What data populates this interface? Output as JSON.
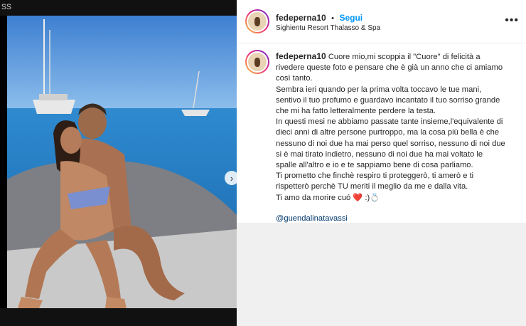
{
  "background": {
    "left_text": "ss",
    "close_glyph": "✕"
  },
  "post": {
    "username": "fedeperna10",
    "bullet": "•",
    "follow_label": "Segui",
    "location": "Sighientu Resort Thalasso & Spa",
    "more_label": "•••",
    "caption_lines": [
      "Cuore mio,mi scoppia il \"Cuore\" di felicità a",
      "rivedere queste foto e pensare che è già un anno che ci amiamo",
      "così tanto.",
      "Sembra ieri quando per la prima volta toccavo le tue mani,",
      "sentivo il tuo profumo e guardavo incantato il tuo sorriso grande",
      "che mi ha fatto letteralmente perdere la testa.",
      "In questi mesi ne abbiamo passate tante insieme,l'equivalente di",
      "dieci anni di altre persone purtroppo, ma la cosa più bella è che",
      "nessuno di noi due ha mai perso quel sorriso, nessuno di noi due",
      "si è mai tirato indietro, nessuno di noi due ha mai voltato le",
      "spalle all'altro e io e te sappiamo bene di cosa parliamo.",
      "Ti prometto che finchè respiro ti proteggerò, ti amerò e ti",
      "rispetterò perchè TU meriti il meglio da me e dalla vita.",
      "Ti amo da morire cuó ❤️ :)💍"
    ],
    "mention": "@guendalinatavassi",
    "carousel": {
      "next_glyph": "›",
      "slide_count": 4,
      "active_slide": 1
    }
  },
  "colors": {
    "accent": "#0095f6",
    "mention": "#00376b",
    "heart": "#ed4956"
  }
}
